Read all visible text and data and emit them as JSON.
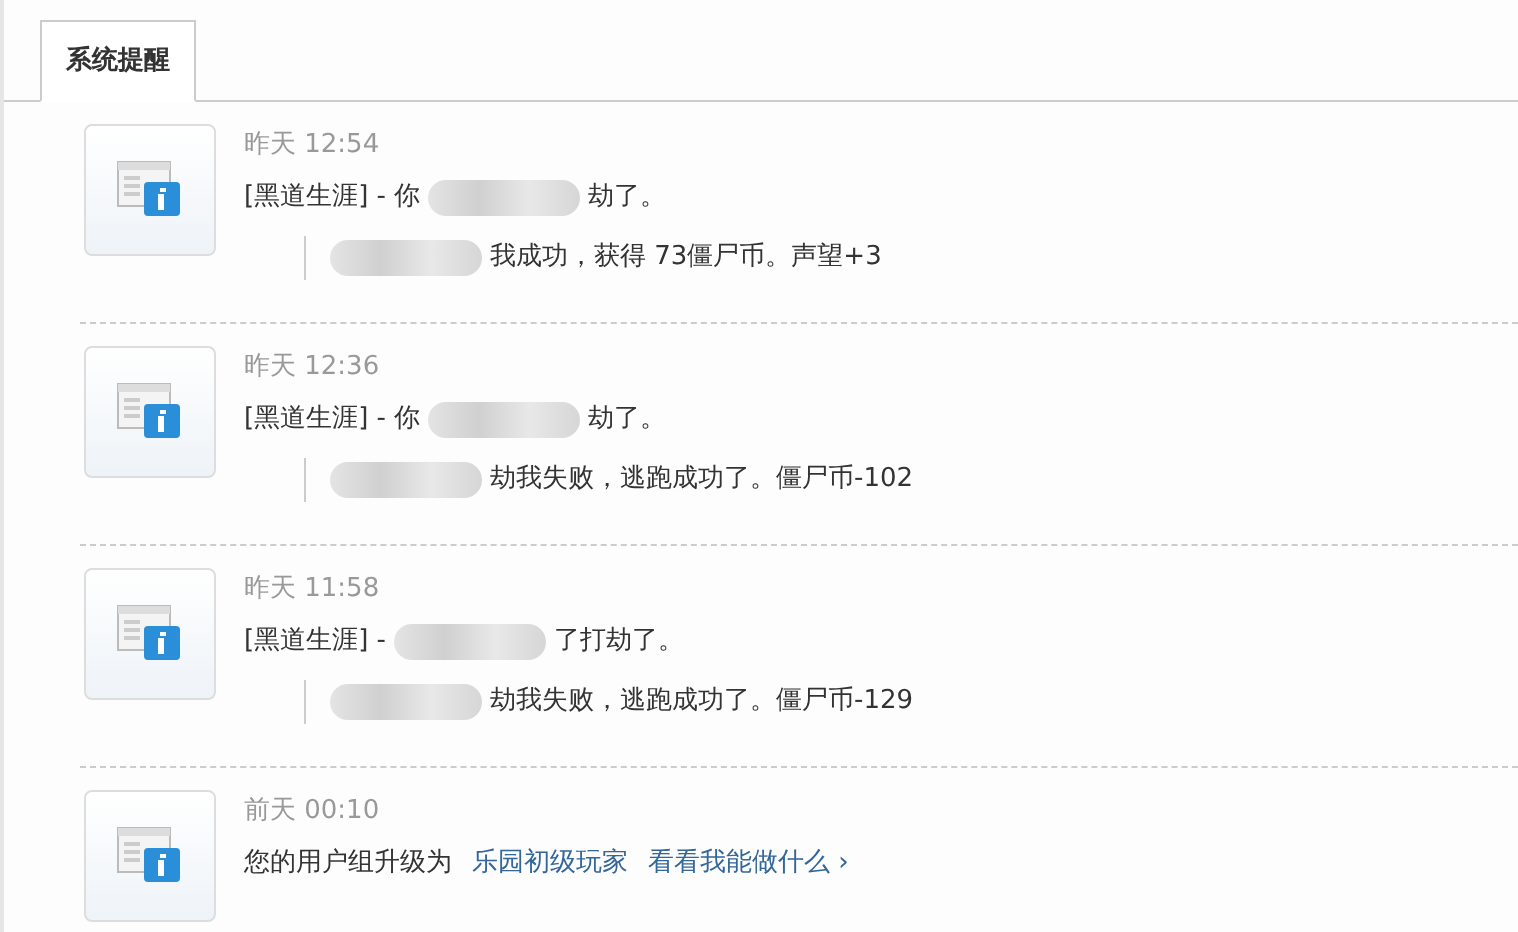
{
  "tabs": [
    {
      "label": "系统提醒",
      "selected": true
    }
  ],
  "notices": [
    {
      "time": "昨天 12:54",
      "message": [
        {
          "kind": "text",
          "text": "[黑道生涯] - 你"
        },
        {
          "kind": "blur"
        },
        {
          "kind": "text",
          "text": "劫了。"
        }
      ],
      "detail": [
        {
          "kind": "blur"
        },
        {
          "kind": "text",
          "text": "我成功，获得 73僵尸币。声望+3"
        }
      ]
    },
    {
      "time": "昨天 12:36",
      "message": [
        {
          "kind": "text",
          "text": "[黑道生涯] - 你"
        },
        {
          "kind": "blur"
        },
        {
          "kind": "text",
          "text": "劫了。"
        }
      ],
      "detail": [
        {
          "kind": "blur"
        },
        {
          "kind": "text",
          "text": "劫我失败，逃跑成功了。僵尸币-102"
        }
      ]
    },
    {
      "time": "昨天 11:58",
      "message": [
        {
          "kind": "text",
          "text": "[黑道生涯] -"
        },
        {
          "kind": "blur"
        },
        {
          "kind": "text",
          "text": "了打劫了。"
        }
      ],
      "detail": [
        {
          "kind": "blur"
        },
        {
          "kind": "text",
          "text": "劫我失败，逃跑成功了。僵尸币-129"
        }
      ]
    },
    {
      "time": "前天 00:10",
      "message": [
        {
          "kind": "text",
          "text": "您的用户组升级为"
        },
        {
          "kind": "link",
          "text": "乐园初级玩家"
        },
        {
          "kind": "link",
          "text": "看看我能做什么 ›"
        }
      ]
    }
  ]
}
